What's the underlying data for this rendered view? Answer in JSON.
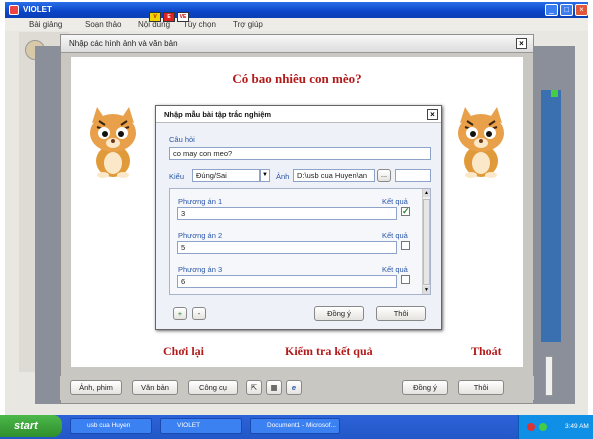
{
  "app": {
    "title": "VIOLET"
  },
  "menu": [
    "Bài giảng",
    "Soạn thảo",
    "Nội dung",
    "Tùy chọn",
    "Trợ giúp"
  ],
  "lang_icons": [
    "V",
    "E",
    "VE"
  ],
  "outer_dialog": {
    "title": "Nhập các hình ảnh và văn bản",
    "question": "Có bao nhiêu con mèo?",
    "links": {
      "retry": "Chơi lại",
      "check": "Kiểm tra kết quả",
      "exit": "Thoát"
    }
  },
  "inner_dialog": {
    "title": "Nhập mẫu bài tập trắc nghiệm",
    "question_label": "Câu hỏi",
    "question_value": "co may con meo?",
    "type_label": "Kiểu",
    "type_value": "Đúng/Sai",
    "image_label": "Ảnh",
    "image_value": "D:\\usb cua  Huyen\\an",
    "browse_label": "...",
    "result_label": "Kết quả",
    "options": [
      {
        "label": "Phương án 1",
        "value": "3",
        "correct": true
      },
      {
        "label": "Phương án 2",
        "value": "5",
        "correct": false
      },
      {
        "label": "Phương án 3",
        "value": "6",
        "correct": false
      }
    ],
    "add_label": "+",
    "remove_label": "-",
    "ok_label": "Đồng ý",
    "exit_label": "Thôi"
  },
  "bottom_bar": {
    "image_film": "Ảnh, phim",
    "text": "Văn bản",
    "tools": "Công cụ",
    "ok": "Đồng ý",
    "cancel": "Thôi"
  },
  "taskbar": {
    "start": "start",
    "items": [
      "usb cua Huyen",
      "VIOLET",
      "Document1 - Microsof..."
    ],
    "clock": "3:49 AM"
  },
  "colors": {
    "accent_red": "#b21a1a",
    "label_blue": "#2a56a8",
    "title_blue": "#0a45c8"
  }
}
